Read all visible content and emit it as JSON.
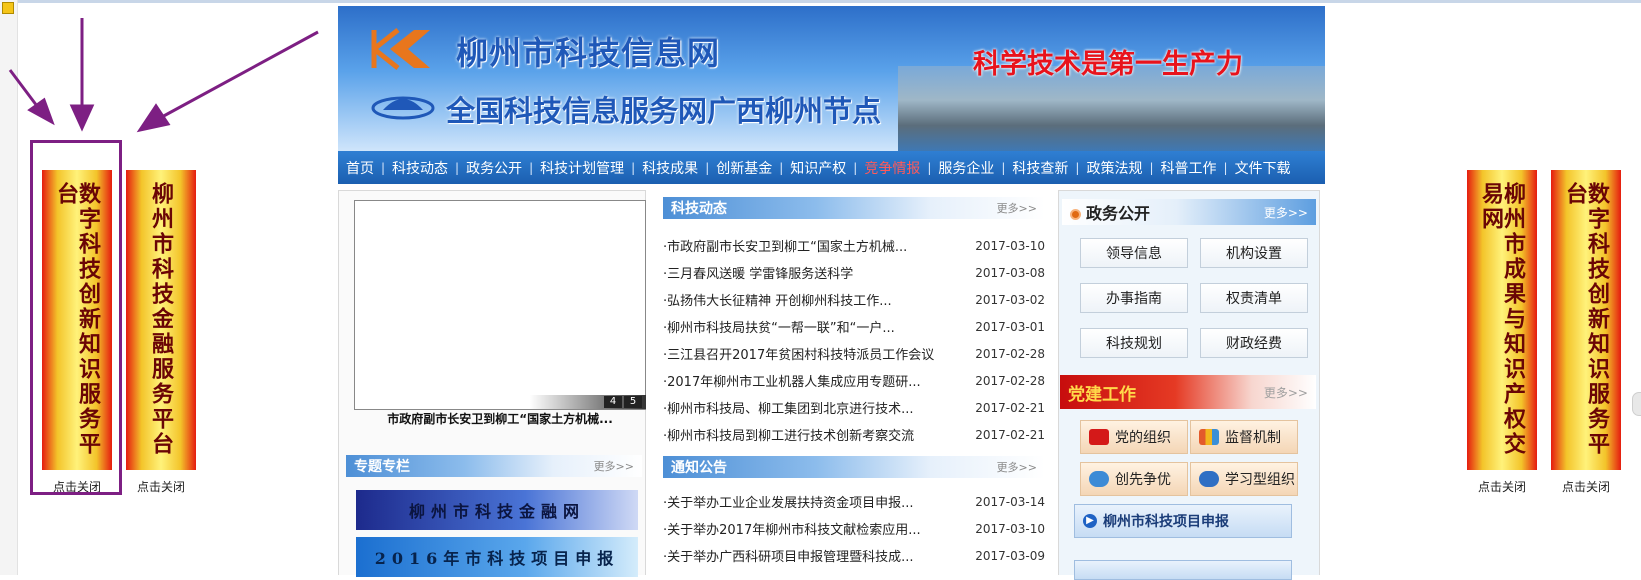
{
  "header": {
    "site_title": "柳州市科技信息网",
    "site_subtitle": "全国科技信息服务网广西柳州节点",
    "slogan": "科学技术是第一生产力"
  },
  "nav": {
    "items": [
      {
        "label": "首页"
      },
      {
        "label": "科技动态"
      },
      {
        "label": "政务公开"
      },
      {
        "label": "科技计划管理"
      },
      {
        "label": "科技成果"
      },
      {
        "label": "创新基金"
      },
      {
        "label": "知识产权"
      },
      {
        "label": "竞争情报"
      },
      {
        "label": "服务企业"
      },
      {
        "label": "科技查新"
      },
      {
        "label": "政策法规"
      },
      {
        "label": "科普工作"
      },
      {
        "label": "文件下载"
      }
    ],
    "active_color": "#ff5a5a"
  },
  "couplets": {
    "left_1": {
      "text": "数字科技创新知识服务平台",
      "close": "点击关闭"
    },
    "left_2": {
      "text": "柳州市科技金融服务平台",
      "close": "点击关闭"
    },
    "right_1": {
      "text": "柳州市成果与知识产权交易网",
      "close": "点击关闭"
    },
    "right_2": {
      "text": "数字科技创新知识服务平台",
      "close": "点击关闭"
    }
  },
  "slideshow": {
    "caption": "市政府副市长安卫到柳工“国家土方机械...",
    "pages": [
      "4",
      "5"
    ]
  },
  "special": {
    "title": "专题专栏",
    "more": "更多>>",
    "promos": [
      "柳州市科技金融网",
      "2016年市科技项目申报"
    ]
  },
  "news": {
    "title": "科技动态",
    "more": "更多>>",
    "items": [
      {
        "title": "·市政府副市长安卫到柳工“国家土方机械...",
        "date": "2017-03-10"
      },
      {
        "title": "·三月春风送暖 学雷锋服务送科学",
        "date": "2017-03-08"
      },
      {
        "title": "·弘扬伟大长征精神 开创柳州科技工作...",
        "date": "2017-03-02"
      },
      {
        "title": "·柳州市科技局扶贫“一帮一联”和“一户...",
        "date": "2017-03-01"
      },
      {
        "title": "·三江县召开2017年贫困村科技特派员工作会议",
        "date": "2017-02-28"
      },
      {
        "title": "·2017年柳州市工业机器人集成应用专题研...",
        "date": "2017-02-28"
      },
      {
        "title": "·柳州市科技局、柳工集团到北京进行技术...",
        "date": "2017-02-21"
      },
      {
        "title": "·柳州市科技局到柳工进行技术创新考察交流",
        "date": "2017-02-21"
      }
    ]
  },
  "notices": {
    "title": "通知公告",
    "more": "更多>>",
    "items": [
      {
        "title": "·关于举办工业企业发展扶持资金项目申报...",
        "date": "2017-03-14"
      },
      {
        "title": "·关于举办2017年柳州市科技文献检索应用...",
        "date": "2017-03-10"
      },
      {
        "title": "·关于举办广西科研项目申报管理暨科技成...",
        "date": "2017-03-09"
      }
    ]
  },
  "gov": {
    "title": "政务公开",
    "more": "更多>>",
    "buttons": [
      "领导信息",
      "机构设置",
      "办事指南",
      "权责清单",
      "科技规划",
      "财政经费"
    ]
  },
  "party": {
    "title": "党建工作",
    "more": "更多>>",
    "buttons": [
      {
        "label": "党的组织",
        "icon": "flag-icon"
      },
      {
        "label": "监督机制",
        "icon": "people-icon"
      },
      {
        "label": "创先争优",
        "icon": "chat-icon"
      },
      {
        "label": "学习型组织",
        "icon": "globe-icon"
      }
    ]
  },
  "project_link": {
    "label": "柳州市科技项目申报"
  }
}
